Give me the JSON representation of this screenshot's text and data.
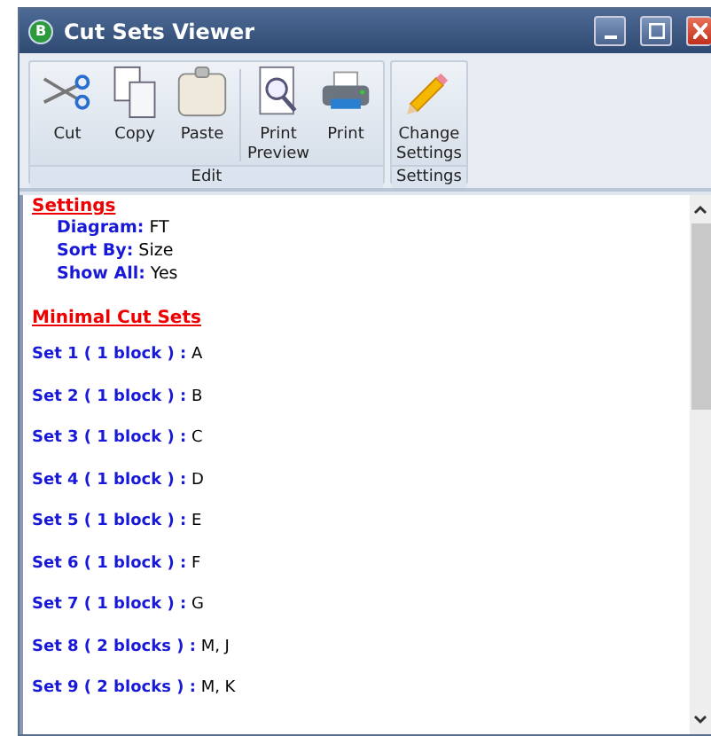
{
  "window": {
    "title": "Cut Sets Viewer",
    "app_badge": "B"
  },
  "ribbon": {
    "groups": [
      {
        "label": "Edit",
        "buttons": [
          {
            "label": "Cut",
            "kind": "scissors"
          },
          {
            "label": "Copy",
            "kind": "copy"
          },
          {
            "label": "Paste",
            "kind": "clipboard"
          },
          {
            "label": "Print Preview",
            "kind": "preview",
            "separator_before": true
          },
          {
            "label": "Print",
            "kind": "printer"
          }
        ]
      },
      {
        "label": "Settings",
        "buttons": [
          {
            "label": "Change Settings",
            "kind": "pencil"
          }
        ]
      }
    ]
  },
  "report": {
    "settings_heading": "Settings",
    "settings": [
      {
        "label": "Diagram:",
        "value": "FT"
      },
      {
        "label": "Sort By:",
        "value": "Size"
      },
      {
        "label": "Show All:",
        "value": "Yes"
      }
    ],
    "sets_heading": "Minimal Cut Sets",
    "sets": [
      {
        "label": "Set 1 ( 1 block ) :",
        "value": "A"
      },
      {
        "label": "Set 2 ( 1 block ) :",
        "value": "B"
      },
      {
        "label": "Set 3 ( 1 block ) :",
        "value": "C"
      },
      {
        "label": "Set 4 ( 1 block ) :",
        "value": "D"
      },
      {
        "label": "Set 5 ( 1 block ) :",
        "value": "E"
      },
      {
        "label": "Set 6 ( 1 block ) :",
        "value": "F"
      },
      {
        "label": "Set 7 ( 1 block ) :",
        "value": "G"
      },
      {
        "label": "Set 8 ( 2 blocks ) :",
        "value": "M, J"
      },
      {
        "label": "Set 9 ( 2 blocks ) :",
        "value": "M, K"
      }
    ]
  }
}
